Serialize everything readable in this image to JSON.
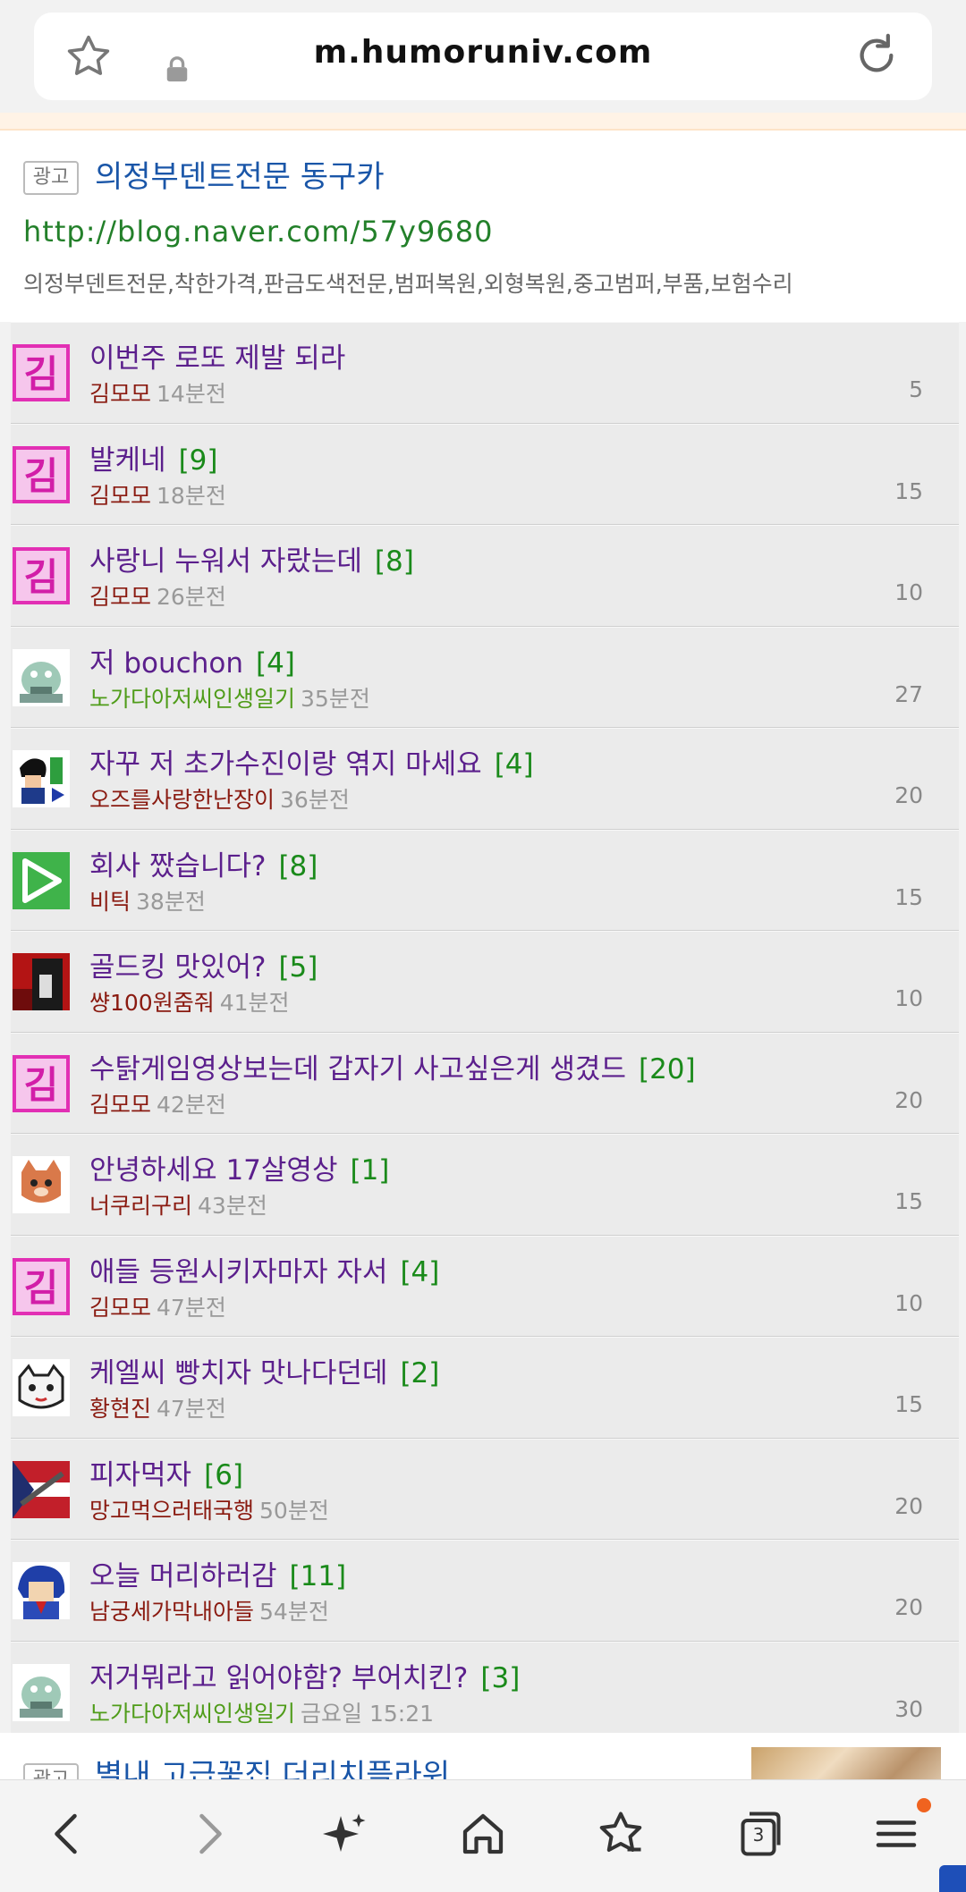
{
  "browser": {
    "url": "m.humoruniv.com",
    "tab_count": "3"
  },
  "top_ad": {
    "badge": "광고",
    "title": "의정부덴트전문 동구카",
    "link": "http://blog.naver.com/57y9680",
    "description": "의정부덴트전문,착한가격,판금도색전문,범퍼복원,외형복원,중고범퍼,부품,보험수리"
  },
  "posts": [
    {
      "title": "이번주 로또 제발 되라",
      "comments": "",
      "author": "김모모",
      "time": "14분전",
      "views": "5",
      "avatar": "kim-badge"
    },
    {
      "title": "발케네",
      "comments": "[9]",
      "author": "김모모",
      "time": "18분전",
      "views": "15",
      "avatar": "kim-badge"
    },
    {
      "title": "사랑니 누워서 자랐는데",
      "comments": "[8]",
      "author": "김모모",
      "time": "26분전",
      "views": "10",
      "avatar": "kim-badge"
    },
    {
      "title": "저 bouchon",
      "comments": "[4]",
      "author": "노가다아저씨인생일기",
      "time": "35분전",
      "views": "27",
      "avatar": "frog"
    },
    {
      "title": "자꾸 저 초가수진이랑 엮지 마세요",
      "comments": "[4]",
      "author": "오즈를사랑한난장이",
      "time": "36분전",
      "views": "20",
      "avatar": "pixel-boy"
    },
    {
      "title": "회사 짰습니다?",
      "comments": "[8]",
      "author": "비틱",
      "time": "38분전",
      "views": "15",
      "avatar": "play"
    },
    {
      "title": "골드킹 맛있어?",
      "comments": "[5]",
      "author": "썅100원줌줘",
      "time": "41분전",
      "views": "10",
      "avatar": "dark-hat"
    },
    {
      "title": "수탉게임영상보는데 갑자기 사고싶은게 생겼드",
      "comments": "[20]",
      "author": "김모모",
      "time": "42분전",
      "views": "20",
      "avatar": "kim-badge"
    },
    {
      "title": "안녕하세요 17살영상",
      "comments": "[1]",
      "author": "너쿠리구리",
      "time": "43분전",
      "views": "15",
      "avatar": "cat"
    },
    {
      "title": "애들 등원시키자마자 자서",
      "comments": "[4]",
      "author": "김모모",
      "time": "47분전",
      "views": "10",
      "avatar": "kim-badge"
    },
    {
      "title": "케엘씨 빵치자 맛나다던데",
      "comments": "[2]",
      "author": "황현진",
      "time": "47분전",
      "views": "15",
      "avatar": "cat-white"
    },
    {
      "title": "피자먹자",
      "comments": "[6]",
      "author": "망고먹으러태국행",
      "time": "50분전",
      "views": "20",
      "avatar": "flag"
    },
    {
      "title": "오늘 머리하러감",
      "comments": "[11]",
      "author": "남궁세가막내아들",
      "time": "54분전",
      "views": "20",
      "avatar": "blue-hair"
    },
    {
      "title": "저거뭐라고 읽어야함? 부어치킨?",
      "comments": "[3]",
      "author": "노가다아저씨인생일기",
      "time": "금요일 15:21",
      "views": "30",
      "avatar": "frog"
    }
  ],
  "bottom_ad": {
    "badge": "광고",
    "title": "별내 고급꽃집 더리치플라워"
  },
  "bottom_nav": [
    "back-icon",
    "forward-icon",
    "sparkle-icon",
    "home-icon",
    "bookmark-star-icon",
    "tabs-icon",
    "menu-icon"
  ]
}
